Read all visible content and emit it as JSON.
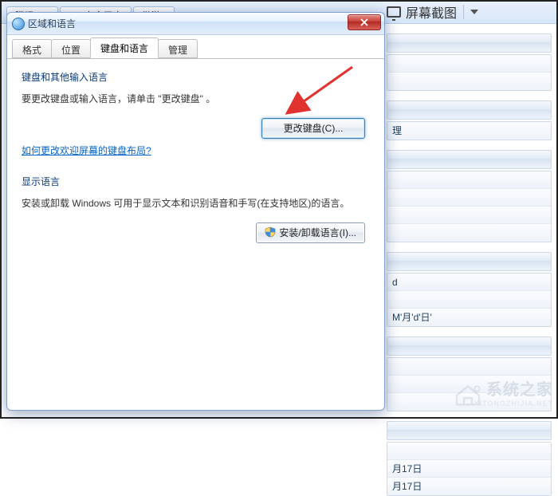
{
  "bg_tabs": [
    "腾讯QQ",
    "360安全卫士",
    "傲游2"
  ],
  "bg_header": {
    "title": "屏幕截图"
  },
  "bg_rows_a": [
    "理"
  ],
  "bg_rows_b": [
    "d"
  ],
  "bg_rows_c": [
    "M'月'd'日'"
  ],
  "bg_rows_d": [
    "",
    "月17日",
    "月17日"
  ],
  "watermark": {
    "line1": "系统之家",
    "line2": "XITONGZHIJIA.NET"
  },
  "dialog": {
    "title": "区域和语言",
    "tabs": {
      "format": "格式",
      "location": "位置",
      "keyboard": "键盘和语言",
      "admin": "管理"
    },
    "group1": {
      "title": "键盘和其他输入语言",
      "text": "要更改键盘或输入语言，请单击 \"更改键盘\" 。",
      "button": "更改键盘(C)...",
      "link": "如何更改欢迎屏幕的键盘布局?"
    },
    "group2": {
      "title": "显示语言",
      "text": "安装或卸载 Windows 可用于显示文本和识别语音和手写(在支持地区)的语言。",
      "button": "安装/卸载语言(I)..."
    }
  }
}
